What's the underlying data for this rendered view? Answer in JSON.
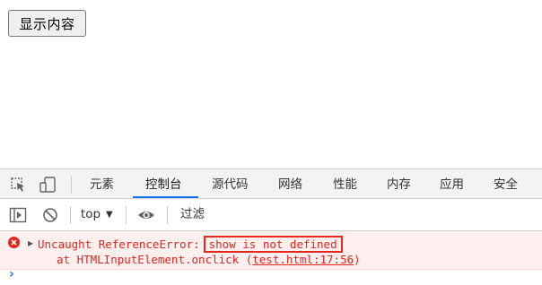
{
  "page": {
    "button_label": "显示内容"
  },
  "devtools": {
    "tabs": [
      {
        "label": "元素",
        "active": false
      },
      {
        "label": "控制台",
        "active": true
      },
      {
        "label": "源代码",
        "active": false
      },
      {
        "label": "网络",
        "active": false
      },
      {
        "label": "性能",
        "active": false
      },
      {
        "label": "内存",
        "active": false
      },
      {
        "label": "应用",
        "active": false
      },
      {
        "label": "安全",
        "active": false
      }
    ],
    "toolbar": {
      "context": "top",
      "filter_placeholder": "过滤"
    },
    "console": {
      "error": {
        "prefix": "Uncaught ReferenceError:",
        "message": "show is not defined",
        "stack_prefix": "at HTMLInputElement.onclick (",
        "stack_link": "test.html:17:56",
        "stack_suffix": ")"
      }
    },
    "icons": {
      "inspect": "inspect-element-icon",
      "device": "device-toggle-icon",
      "sidebar": "console-sidebar-icon",
      "clear": "clear-console-icon",
      "eye": "live-expression-icon",
      "error": "error-icon",
      "prompt": "console-prompt-icon"
    },
    "colors": {
      "error_text": "#e0251b",
      "error_bg": "#fff0f0",
      "active_tab_underline": "#1a73e8",
      "highlight_box": "#e8271b"
    }
  }
}
